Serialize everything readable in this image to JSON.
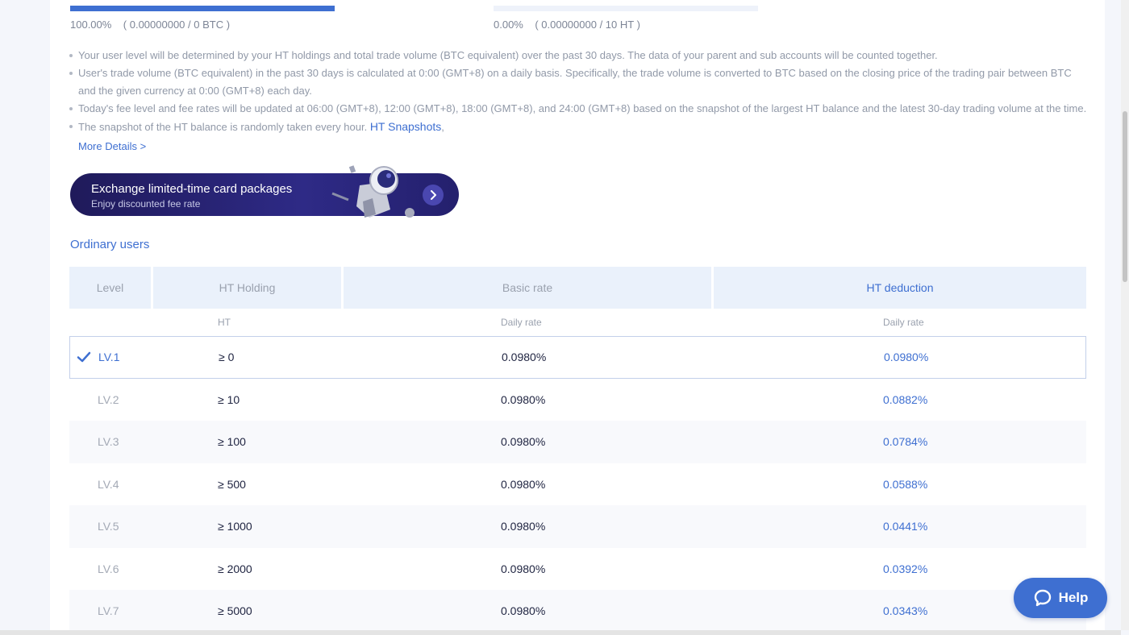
{
  "progress": {
    "btc": {
      "percent": "100.00%",
      "detail": "( 0.00000000 / 0 BTC )",
      "fill": 1.0
    },
    "ht": {
      "percent": "0.00%",
      "detail": "( 0.00000000 / 10 HT )",
      "fill": 0.0
    }
  },
  "notes": {
    "n1": "Your user level will be determined by your HT holdings and total trade volume (BTC equivalent) over the past 30 days. The data of your parent and sub accounts will be counted together.",
    "n2a": "User's trade volume (BTC equivalent) in the past 30 days is calculated at 0:00 (GMT+8) on a daily basis. Specifically, the trade volume is converted to BTC based on the closing price of the trading pair between BTC",
    "n2b": "and the given currency at 0:00 (GMT+8) each day.",
    "n3": "Today's fee level and fee rates will be updated at 06:00 (GMT+8), 12:00 (GMT+8), 18:00 (GMT+8), and 24:00 (GMT+8) based on the snapshot of the largest HT balance and the latest 30-day trading volume at the time.",
    "n4": "The snapshot of the HT balance is randomly taken every hour.",
    "n4_link": "HT Snapshots",
    "n4_tail": ","
  },
  "more_details": "More Details >",
  "banner": {
    "title": "Exchange limited-time card packages",
    "subtitle": "Enjoy discounted fee rate"
  },
  "section_title": "Ordinary users",
  "table": {
    "headers": {
      "level": "Level",
      "holding": "HT Holding",
      "basic": "Basic rate",
      "deduction": "HT deduction"
    },
    "subheaders": {
      "holding": "HT",
      "basic": "Daily rate",
      "deduction": "Daily rate"
    },
    "rows": [
      {
        "level": "LV.1",
        "holding": "≥ 0",
        "basic": "0.0980%",
        "deduction": "0.0980%"
      },
      {
        "level": "LV.2",
        "holding": "≥ 10",
        "basic": "0.0980%",
        "deduction": "0.0882%"
      },
      {
        "level": "LV.3",
        "holding": "≥ 100",
        "basic": "0.0980%",
        "deduction": "0.0784%"
      },
      {
        "level": "LV.4",
        "holding": "≥ 500",
        "basic": "0.0980%",
        "deduction": "0.0588%"
      },
      {
        "level": "LV.5",
        "holding": "≥ 1000",
        "basic": "0.0980%",
        "deduction": "0.0441%"
      },
      {
        "level": "LV.6",
        "holding": "≥ 2000",
        "basic": "0.0980%",
        "deduction": "0.0392%"
      },
      {
        "level": "LV.7",
        "holding": "≥ 5000",
        "basic": "0.0980%",
        "deduction": "0.0343%"
      }
    ]
  },
  "help": {
    "label": "Help"
  },
  "colors": {
    "accent": "#3e6fd1",
    "banner": "#24206d",
    "header_bg": "#eaf1fb"
  },
  "icons": {
    "check": "check-icon",
    "arrow": "chevron-right-icon",
    "help": "chat-bubble-icon"
  }
}
